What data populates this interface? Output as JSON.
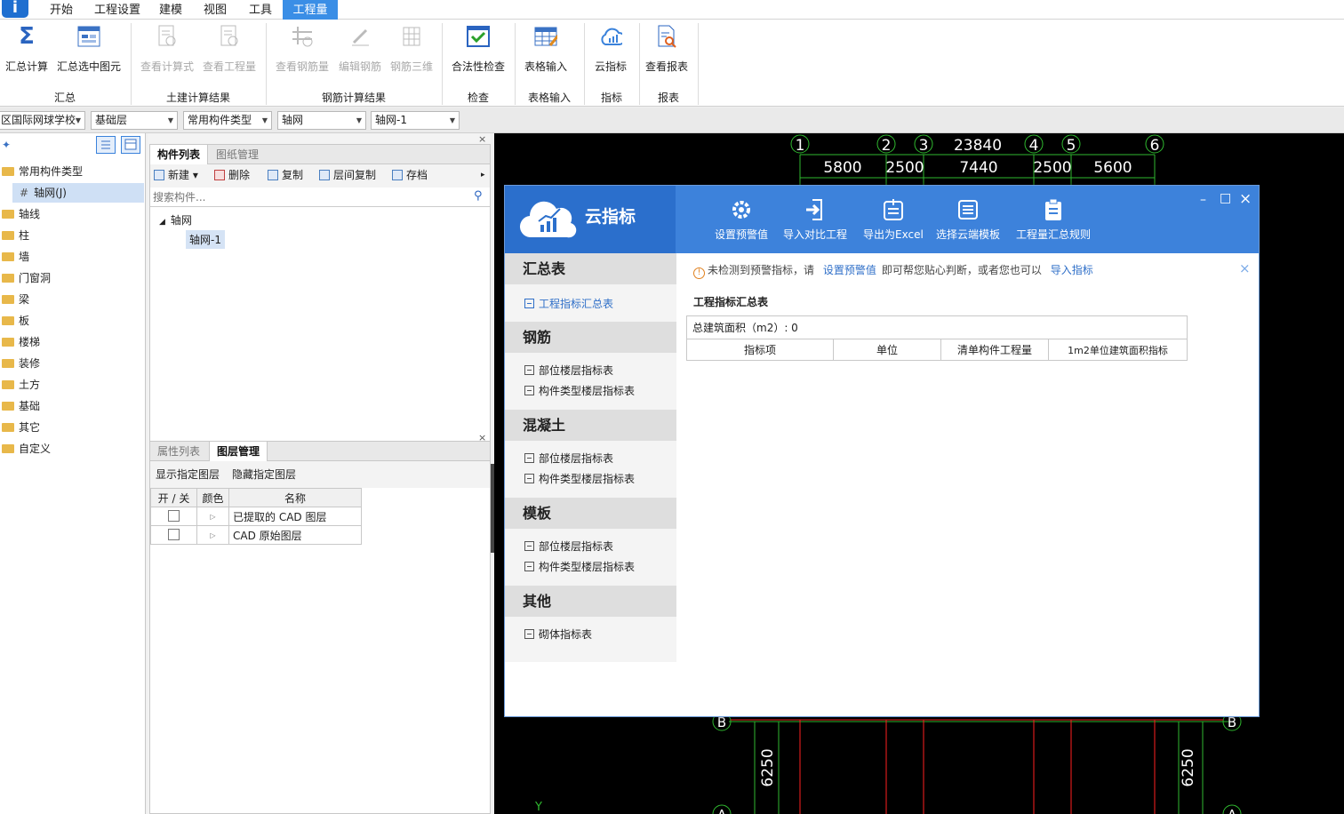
{
  "menu": {
    "tabs": [
      "开始",
      "工程设置",
      "建模",
      "视图",
      "工具",
      "工程量"
    ],
    "active_index": 5
  },
  "ribbon": {
    "buttons": [
      "汇总计算",
      "汇总选中图元",
      "查看计算式",
      "查看工程量",
      "查看钢筋量",
      "编辑钢筋",
      "钢筋三维",
      "合法性检查",
      "表格输入",
      "云指标",
      "查看报表"
    ],
    "groups": [
      "汇总",
      "土建计算结果",
      "钢筋计算结果",
      "检查",
      "表格输入",
      "指标",
      "报表"
    ]
  },
  "combos": [
    "区国际网球学校",
    "基础层",
    "常用构件类型",
    "轴网",
    "轴网-1"
  ],
  "left_tree": {
    "root": "常用构件类型",
    "selected": "轴网(J)",
    "items": [
      "轴线",
      "柱",
      "墙",
      "门窗洞",
      "梁",
      "板",
      "楼梯",
      "装修",
      "土方",
      "基础",
      "其它",
      "自定义"
    ]
  },
  "component_panel": {
    "tabs": [
      "构件列表",
      "图纸管理"
    ],
    "tools": [
      "新建",
      "删除",
      "复制",
      "层间复制",
      "存档"
    ],
    "search_placeholder": "搜索构件...",
    "tree_parent": "轴网",
    "tree_child": "轴网-1"
  },
  "layer_panel": {
    "tabs": [
      "属性列表",
      "图层管理"
    ],
    "tools": [
      "显示指定图层",
      "隐藏指定图层"
    ],
    "headers": [
      "开 / 关",
      "颜色",
      "名称"
    ],
    "rows": [
      "已提取的 CAD 图层",
      "CAD 原始图层"
    ]
  },
  "cad": {
    "axis_numbers": [
      "1",
      "2",
      "3",
      "4",
      "5",
      "6"
    ],
    "total_dimension": "23840",
    "dimensions": [
      "5800",
      "2500",
      "7440",
      "2500",
      "5600"
    ],
    "row_label": "B",
    "bottom_label": "A",
    "side_dimension": "6250",
    "y_label": "Y"
  },
  "cloud_dialog": {
    "title": "云指标",
    "toolbar": [
      "设置预警值",
      "导入对比工程",
      "导出为Excel",
      "选择云端模板",
      "工程量汇总规则"
    ],
    "window_controls": [
      "–",
      "□",
      "×"
    ],
    "sections": [
      {
        "title": "汇总表",
        "items": [
          "工程指标汇总表"
        ]
      },
      {
        "title": "钢筋",
        "items": [
          "部位楼层指标表",
          "构件类型楼层指标表"
        ]
      },
      {
        "title": "混凝土",
        "items": [
          "部位楼层指标表",
          "构件类型楼层指标表"
        ]
      },
      {
        "title": "模板",
        "items": [
          "部位楼层指标表",
          "构件类型楼层指标表"
        ]
      },
      {
        "title": "其他",
        "items": [
          "砌体指标表"
        ]
      }
    ],
    "notice": {
      "prefix": "未检测到预警指标，请",
      "link1": "设置预警值",
      "middle": "即可帮您贴心判断，或者您也可以",
      "link2": "导入指标"
    },
    "table_title": "工程指标汇总表",
    "area_label": "总建筑面积（m2）: 0",
    "columns": [
      "指标项",
      "单位",
      "清单构件工程量",
      "1m2单位建筑面积指标"
    ]
  }
}
